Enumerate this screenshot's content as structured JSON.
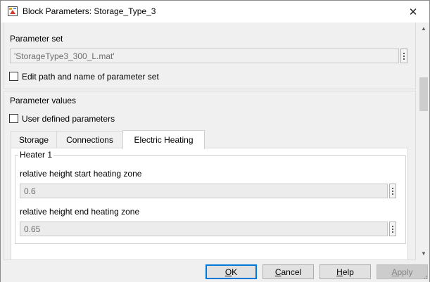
{
  "window": {
    "title": "Block Parameters: Storage_Type_3",
    "close_glyph": "✕",
    "icon": "simulink-block-icon"
  },
  "parameter_set": {
    "label": "Parameter set",
    "value": "'StorageType3_300_L.mat'",
    "edit_checkbox_label": "Edit path and name of parameter set",
    "edit_checked": false
  },
  "parameter_values": {
    "section_label": "Parameter values",
    "user_defined_label": "User defined parameters",
    "user_defined_checked": false
  },
  "tabs": [
    {
      "label": "Storage",
      "active": false
    },
    {
      "label": "Connections",
      "active": false
    },
    {
      "label": "Electric Heating",
      "active": true
    }
  ],
  "heater": {
    "group_title": "Heater 1",
    "start_label": "relative height start heating zone",
    "start_value": "0.6",
    "end_label": "relative height end heating zone",
    "end_value": "0.65"
  },
  "buttons": {
    "ok_mnemonic": "O",
    "ok_rest": "K",
    "cancel_mnemonic": "C",
    "cancel_rest": "ancel",
    "help_mnemonic": "H",
    "help_rest": "elp",
    "apply_mnemonic": "A",
    "apply_rest": "pply",
    "apply_enabled": false
  },
  "colors": {
    "focus_border": "#0078d7",
    "window_bg": "#f0f0f0"
  }
}
